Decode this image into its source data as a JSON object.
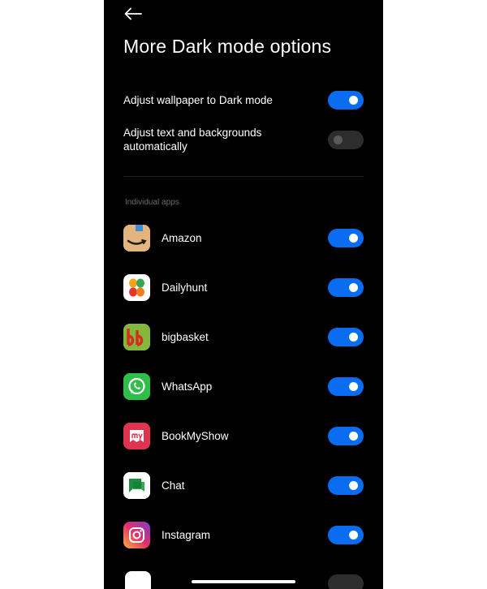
{
  "header": {
    "title": "More Dark mode options",
    "back_icon": "arrow-left-icon"
  },
  "settings": [
    {
      "label": "Adjust wallpaper to Dark mode",
      "enabled": true
    },
    {
      "label": "Adjust text and backgrounds automatically",
      "enabled": false
    }
  ],
  "section_label": "Individual apps",
  "apps": [
    {
      "name": "Amazon",
      "icon": "amazon-icon",
      "enabled": true
    },
    {
      "name": "Dailyhunt",
      "icon": "dailyhunt-icon",
      "enabled": true
    },
    {
      "name": "bigbasket",
      "icon": "bigbasket-icon",
      "enabled": true
    },
    {
      "name": "WhatsApp",
      "icon": "whatsapp-icon",
      "enabled": true
    },
    {
      "name": "BookMyShow",
      "icon": "bookmyshow-icon",
      "enabled": true
    },
    {
      "name": "Chat",
      "icon": "google-chat-icon",
      "enabled": true
    },
    {
      "name": "Instagram",
      "icon": "instagram-icon",
      "enabled": true
    }
  ],
  "colors": {
    "toggle_on": "#0a6cf0",
    "toggle_off": "#2d2d2d",
    "background": "#000000",
    "text": "#ffffff"
  }
}
